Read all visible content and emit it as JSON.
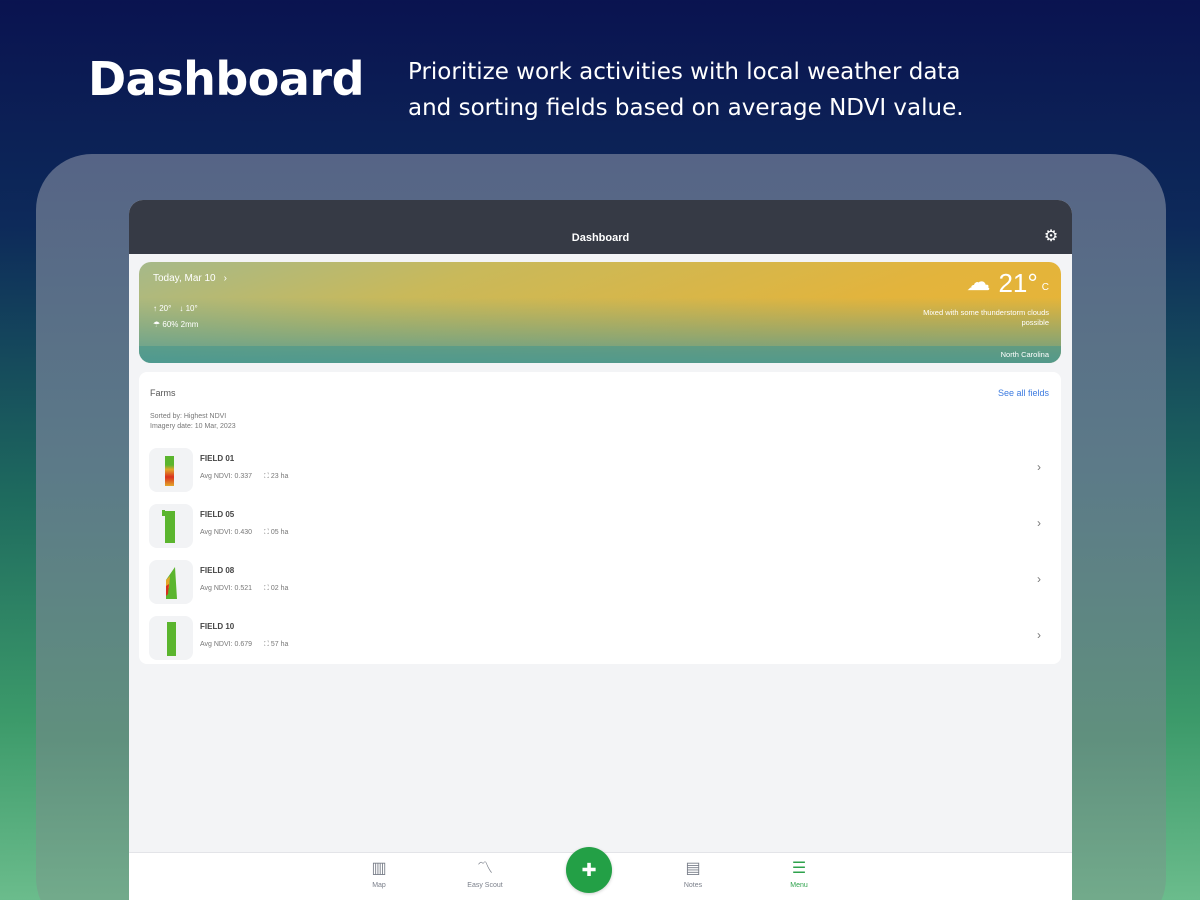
{
  "hero": {
    "title": "Dashboard",
    "description": "Prioritize work activities with local weather data and sorting fields based on average NDVI value."
  },
  "topbar": {
    "title": "Dashboard",
    "settings_icon": "gear-icon"
  },
  "weather": {
    "date": "Today, Mar 10",
    "high": "20°",
    "low": "10°",
    "precip": "60%  2mm",
    "temperature": "21°",
    "unit": "C",
    "conditions": "Mixed with some thunderstorm clouds possible",
    "location": "North Carolina",
    "icon": "cloud-thunder-icon"
  },
  "farms": {
    "title": "Farms",
    "see_all": "See all fields",
    "sorted_by": "Sorted by: Highest NDVI",
    "imagery_date": "Imagery date: 10 Mar, 2023",
    "fields": [
      {
        "name": "FIELD 01",
        "ndvi": "Avg NDVI: 0.337",
        "area": "23 ha"
      },
      {
        "name": "FIELD 05",
        "ndvi": "Avg NDVI: 0.430",
        "area": "05 ha"
      },
      {
        "name": "FIELD 08",
        "ndvi": "Avg NDVI: 0.521",
        "area": "02 ha"
      },
      {
        "name": "FIELD 10",
        "ndvi": "Avg NDVI: 0.679",
        "area": "57 ha"
      }
    ]
  },
  "nav": {
    "items": [
      {
        "label": "Map",
        "icon": "map-icon"
      },
      {
        "label": "Easy Scout",
        "icon": "scout-icon"
      },
      {
        "label": "Notes",
        "icon": "notes-icon"
      },
      {
        "label": "Menu",
        "icon": "menu-icon"
      }
    ],
    "fab_icon": "add-note-icon"
  },
  "colors": {
    "accent": "#23a046",
    "topbar": "#363a45",
    "link": "#3d7be0",
    "ndvi_high": "#5bb52e",
    "ndvi_low": "#d9301f"
  }
}
